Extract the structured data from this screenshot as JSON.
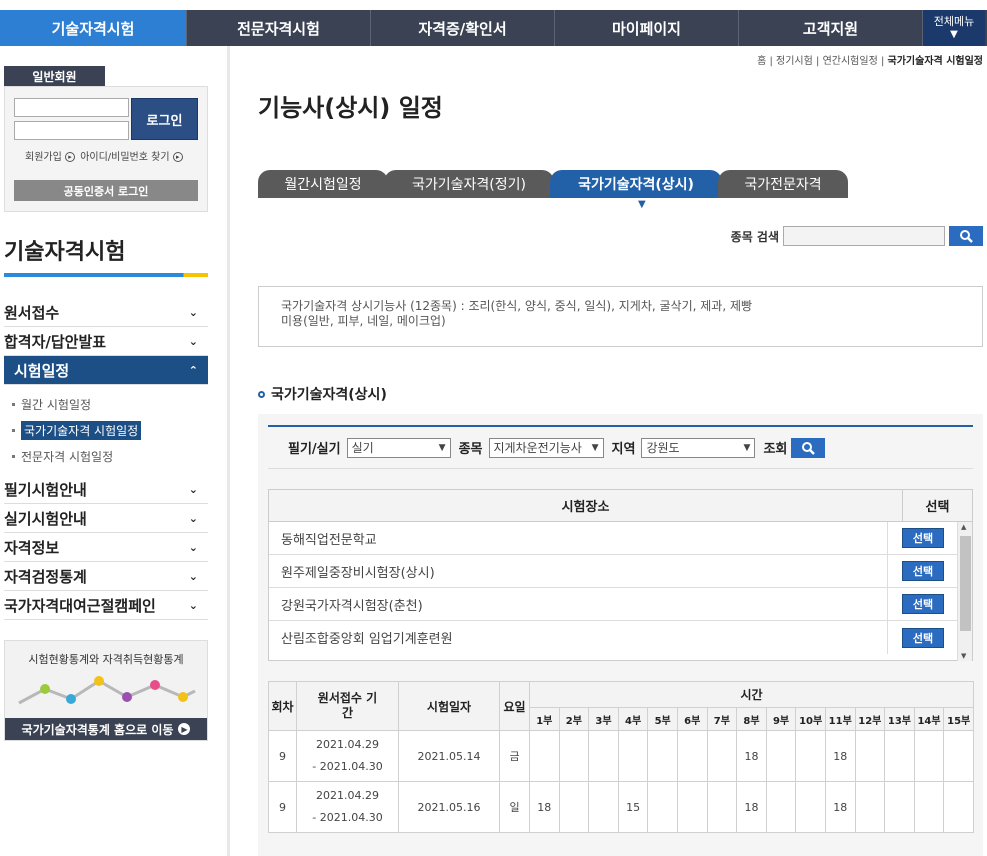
{
  "gnb": {
    "items": [
      "기술자격시험",
      "전문자격시험",
      "자격증/확인서",
      "마이페이지",
      "고객지원"
    ],
    "all_menu": "전체메뉴"
  },
  "login": {
    "tag": "일반회원",
    "button": "로그인",
    "join": "회원가입",
    "find": "아이디/비밀번호 찾기",
    "cert": "공동인증서 로그인"
  },
  "sidebar": {
    "title": "기술자격시험",
    "items": [
      "원서접수",
      "합격자/답안발표",
      "시험일정",
      "필기시험안내",
      "실기시험안내",
      "자격정보",
      "자격검정통계",
      "국가자격대여근절캠페인"
    ],
    "sub_items": [
      "월간 시험일정",
      "국가기술자격 시험일정",
      "전문자격 시험일정"
    ]
  },
  "banner": {
    "text": "시험현황통계와 자격취득현황통계",
    "link": "국가기술자격통계 홈으로 이동"
  },
  "breadcrumb": [
    "홈",
    "정기시험",
    "연간시험일정",
    "국가기술자격 시험일정"
  ],
  "page_title": "기능사(상시) 일정",
  "tabs": [
    "월간시험일정",
    "국가기술자격(정기)",
    "국가기술자격(상시)",
    "국가전문자격"
  ],
  "search": {
    "label": "종목 검색",
    "value": ""
  },
  "info": {
    "line1": "국가기술자격 상시기능사 (12종목) : 조리(한식, 양식, 중식, 일식), 지게차, 굴삭기, 제과, 제빵",
    "line2": "미용(일반, 피부, 네일, 메이크업)"
  },
  "section_title": "국가기술자격(상시)",
  "filter": {
    "type_label": "필기/실기",
    "type_value": "실기",
    "item_label": "종목",
    "item_value": "지게차운전기능사",
    "region_label": "지역",
    "region_value": "강원도",
    "query_label": "조회"
  },
  "places": {
    "header_name": "시험장소",
    "header_select": "선택",
    "select_label": "선택",
    "rows": [
      "동해직업전문학교",
      "원주제일중장비시험장(상시)",
      "강원국가자격시험장(춘천)",
      "산림조합중앙회 임업기계훈련원"
    ]
  },
  "schedule": {
    "h_round": "회차",
    "h_apply": "원서접수 기간",
    "h_date": "시험일자",
    "h_day": "요일",
    "h_time": "시간",
    "sessions": [
      "1부",
      "2부",
      "3부",
      "4부",
      "5부",
      "6부",
      "7부",
      "8부",
      "9부",
      "10부",
      "11부",
      "12부",
      "13부",
      "14부",
      "15부"
    ],
    "rows": [
      {
        "round": "9",
        "apply_start": "2021.04.29",
        "apply_end": "- 2021.04.30",
        "date": "2021.05.14",
        "day": "금",
        "slots": [
          "",
          "",
          "",
          "",
          "",
          "",
          "",
          "18",
          "",
          "",
          "18",
          "",
          "",
          "",
          ""
        ]
      },
      {
        "round": "9",
        "apply_start": "2021.04.29",
        "apply_end": "- 2021.04.30",
        "date": "2021.05.16",
        "day": "일",
        "slots": [
          "18",
          "",
          "",
          "15",
          "",
          "",
          "",
          "18",
          "",
          "",
          "18",
          "",
          "",
          "",
          ""
        ]
      }
    ]
  }
}
